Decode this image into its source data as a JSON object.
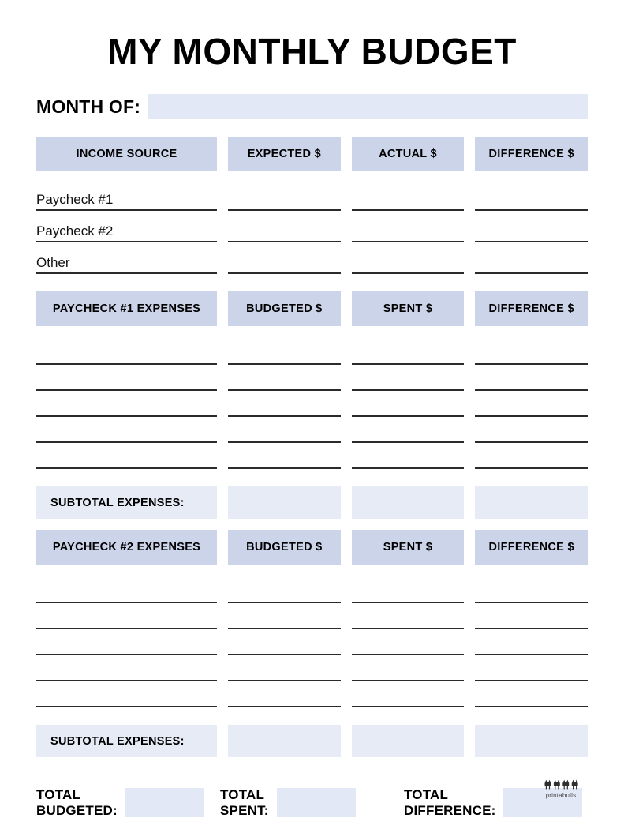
{
  "document": {
    "title": "MY MONTHLY BUDGET"
  },
  "month": {
    "label": "MONTH OF:",
    "value": "",
    "placeholder": ""
  },
  "income_section": {
    "headers": [
      "INCOME SOURCE",
      "EXPECTED $",
      "ACTUAL $",
      "DIFFERENCE $"
    ],
    "rows": [
      {
        "label": "Paycheck #1",
        "expected": "",
        "actual": "",
        "difference": ""
      },
      {
        "label": "Paycheck #2",
        "expected": "",
        "actual": "",
        "difference": ""
      },
      {
        "label": "Other",
        "expected": "",
        "actual": "",
        "difference": ""
      }
    ]
  },
  "paycheck1_section": {
    "headers": [
      "PAYCHECK #1 EXPENSES",
      "BUDGETED $",
      "SPENT $",
      "DIFFERENCE $"
    ],
    "rows": [
      {
        "label": "",
        "budgeted": "",
        "spent": "",
        "difference": ""
      },
      {
        "label": "",
        "budgeted": "",
        "spent": "",
        "difference": ""
      },
      {
        "label": "",
        "budgeted": "",
        "spent": "",
        "difference": ""
      },
      {
        "label": "",
        "budgeted": "",
        "spent": "",
        "difference": ""
      },
      {
        "label": "",
        "budgeted": "",
        "spent": "",
        "difference": ""
      }
    ],
    "subtotal": {
      "label": "SUBTOTAL EXPENSES:",
      "budgeted": "",
      "spent": "",
      "difference": ""
    }
  },
  "paycheck2_section": {
    "headers": [
      "PAYCHECK #2 EXPENSES",
      "BUDGETED $",
      "SPENT $",
      "DIFFERENCE $"
    ],
    "rows": [
      {
        "label": "",
        "budgeted": "",
        "spent": "",
        "difference": ""
      },
      {
        "label": "",
        "budgeted": "",
        "spent": "",
        "difference": ""
      },
      {
        "label": "",
        "budgeted": "",
        "spent": "",
        "difference": ""
      },
      {
        "label": "",
        "budgeted": "",
        "spent": "",
        "difference": ""
      },
      {
        "label": "",
        "budgeted": "",
        "spent": "",
        "difference": ""
      }
    ],
    "subtotal": {
      "label": "SUBTOTAL EXPENSES:",
      "budgeted": "",
      "spent": "",
      "difference": ""
    }
  },
  "totals": [
    {
      "label": "TOTAL\nBUDGETED:",
      "value": ""
    },
    {
      "label": "TOTAL\nSPENT:",
      "value": ""
    },
    {
      "label": "TOTAL\nDIFFERENCE:",
      "value": ""
    }
  ],
  "footer": {
    "brand": "printabulls",
    "logo_icon": "three-bulls-icon"
  },
  "colors": {
    "header_fill": "#ccd4ea",
    "field_fill": "#e3e8f6",
    "subtotal_fill": "#e7ebf6",
    "rule": "#2b2b2b",
    "text": "#000000",
    "page": "#ffffff"
  }
}
